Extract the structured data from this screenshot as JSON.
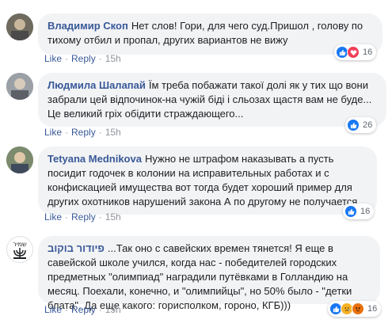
{
  "actions": {
    "like": "Like",
    "reply": "Reply",
    "separator": "·"
  },
  "comments": [
    {
      "author": "Владимир Скоп",
      "text": "Нет слов! Гори, для чего суд.Пришол , голову по тихому отбил и пропал, других вариантов не вижу",
      "time": "15h",
      "reaction_icons": [
        "like-icon",
        "love-icon"
      ],
      "reactions_count": "16"
    },
    {
      "author": "Людмила Шалапай",
      "text": "Їм треба побажати такої долі як у тих що вони забрали цей відпочинок-на чужій біді і сльозах щастя вам не буде... Це великий гріх обідити страждающего...",
      "time": "15h",
      "reaction_icons": [
        "like-icon"
      ],
      "reactions_count": "26"
    },
    {
      "author": "Tetyana Mednikova",
      "text": "Нужно не штрафом наказывать а пусть посидит годочек в колонии на исправительных работах и с конфискацией имущества вот тогда будет хороший пример для других охотников нарушений закона А по другому не получается",
      "time": "15h",
      "reaction_icons": [
        "like-icon"
      ],
      "reactions_count": "16"
    },
    {
      "author": "פיודור בוקוב",
      "text": "...Так оно с савейских времен тянется! Я еще в савейской школе учился, когда нас - победителей городских предметных \"олимпиад\" наградили путёвками в Голландию на месяц. Поехали, конечно, и \"олимпийцы\", но 50% было - \"детки блата\". Да еще какого: горисполком, гороно, КГБ)))",
      "time": "15h",
      "reaction_icons": [
        "like-icon",
        "sad-icon",
        "angry-icon"
      ],
      "reactions_count": "16"
    }
  ],
  "colors": {
    "author": "#385898",
    "bubble": "#f2f3f5",
    "like": "#1877f2",
    "love": "#f33e58"
  }
}
